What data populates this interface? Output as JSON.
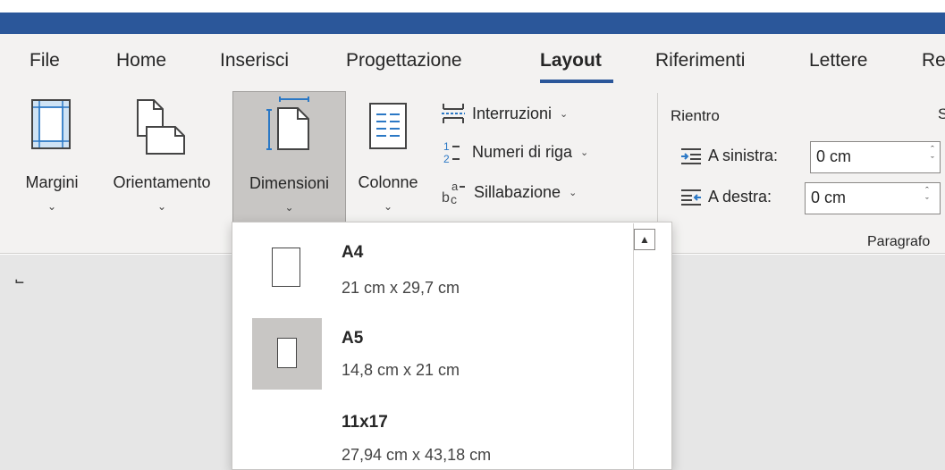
{
  "tabs": [
    {
      "label": "File",
      "active": false
    },
    {
      "label": "Home",
      "active": false
    },
    {
      "label": "Inserisci",
      "active": false
    },
    {
      "label": "Progettazione",
      "active": false
    },
    {
      "label": "Layout",
      "active": true
    },
    {
      "label": "Riferimenti",
      "active": false
    },
    {
      "label": "Lettere",
      "active": false
    },
    {
      "label": "Re",
      "active": false
    }
  ],
  "ribbon": {
    "margini": "Margini",
    "orientamento": "Orientamento",
    "dimensioni": "Dimensioni",
    "colonne": "Colonne",
    "interruzioni": "Interruzioni",
    "numeri_riga": "Numeri di riga",
    "sillabazione": "Sillabazione",
    "rientro": "Rientro",
    "a_sinistra": "A sinistra:",
    "a_sinistra_value": "0 cm",
    "a_destra": "A destra:",
    "a_destra_value": "0 cm",
    "paragrafo": "Paragrafo",
    "spaziatura_partial": "S"
  },
  "dropdown": {
    "items": [
      {
        "name": "A4",
        "size": "21 cm x 29,7 cm",
        "selected": false
      },
      {
        "name": "A5",
        "size": "14,8 cm x 21 cm",
        "selected": true
      },
      {
        "name": "11x17",
        "size": "27,94 cm x 43,18 cm",
        "selected": false
      }
    ]
  },
  "colors": {
    "title_bar": "#2b579a",
    "ribbon_bg": "#f3f2f1",
    "pressed_bg": "#c8c6c4",
    "doc_bg": "#e6e6e6",
    "accent_blue": "#2b579a"
  },
  "icons": [
    "margins-icon",
    "orientation-icon",
    "size-icon",
    "columns-icon",
    "breaks-icon",
    "line-numbers-icon",
    "hyphenation-icon",
    "indent-left-icon",
    "indent-right-icon",
    "scroll-up-icon",
    "page-icon"
  ]
}
